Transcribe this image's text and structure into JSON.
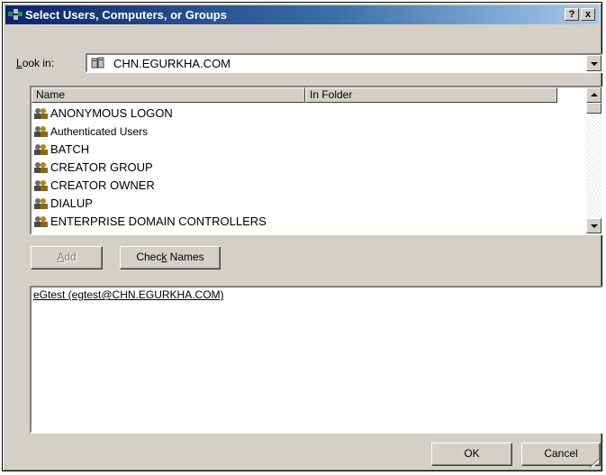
{
  "window": {
    "title": "Select Users, Computers, or Groups",
    "help_label": "?",
    "close_label": "x"
  },
  "lookin": {
    "label_prefix": "",
    "label_hot": "L",
    "label_rest": "ook in:",
    "value": "CHN.EGURKHA.COM"
  },
  "list": {
    "columns": [
      "Name",
      "In Folder"
    ],
    "items": [
      {
        "name": "ANONYMOUS LOGON"
      },
      {
        "name": "Authenticated Users"
      },
      {
        "name": "BATCH"
      },
      {
        "name": "CREATOR GROUP"
      },
      {
        "name": "CREATOR OWNER"
      },
      {
        "name": "DIALUP"
      },
      {
        "name": "ENTERPRISE DOMAIN CONTROLLERS"
      }
    ]
  },
  "buttons": {
    "add_hot": "A",
    "add_rest": "dd",
    "check_pre": "Chec",
    "check_hot": "k",
    "check_post": " Names",
    "ok": "OK",
    "cancel": "Cancel"
  },
  "selected_names": "eGtest (egtest@CHN.EGURKHA.COM)",
  "colors": {
    "title_start": "#0a246a",
    "title_end": "#a6caf0",
    "face": "#d4d0c8"
  },
  "icons": [
    "app-icon",
    "help-icon",
    "close-icon",
    "domain-icon",
    "group-icon",
    "dropdown-arrow-icon",
    "scroll-up-icon",
    "scroll-down-icon",
    "resize-grip-icon"
  ]
}
